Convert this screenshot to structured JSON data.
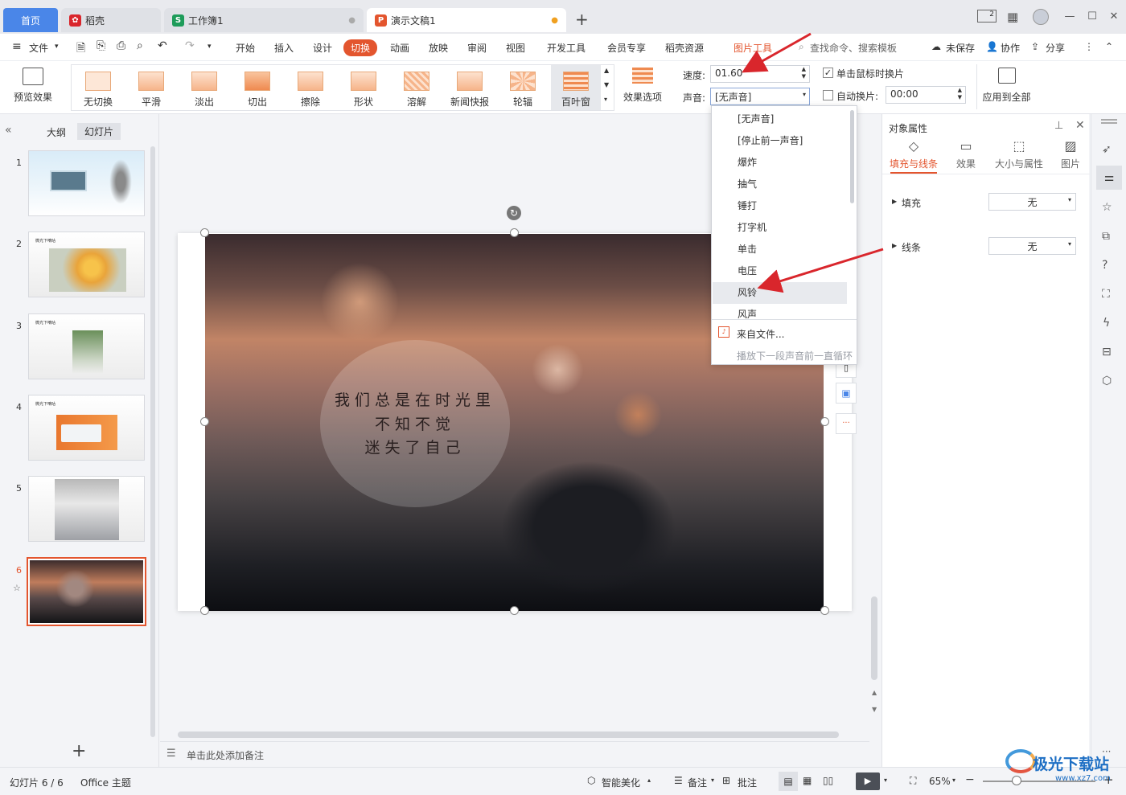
{
  "tabs": [
    {
      "label": "首页"
    },
    {
      "label": "稻壳"
    },
    {
      "label": "工作簿1"
    },
    {
      "label": "演示文稿1"
    }
  ],
  "window": {
    "add_tab": "+",
    "badge": "2"
  },
  "menu": {
    "file": "文件",
    "items": [
      "开始",
      "插入",
      "设计",
      "切换",
      "动画",
      "放映",
      "审阅",
      "视图",
      "开发工具",
      "会员专享",
      "稻壳资源",
      "图片工具"
    ],
    "search": "查找命令、搜索模板",
    "unsaved": "未保存",
    "collab": "协作",
    "share": "分享"
  },
  "ribbon": {
    "preview": "预览效果",
    "effects": [
      "无切换",
      "平滑",
      "淡出",
      "切出",
      "擦除",
      "形状",
      "溶解",
      "新闻快报",
      "轮辐",
      "百叶窗"
    ],
    "effect_options": "效果选项",
    "speed_label": "速度:",
    "speed_value": "01.60",
    "sound_label": "声音:",
    "sound_value": "[无声音]",
    "click_switch": "单击鼠标时换片",
    "auto_switch": "自动换片:",
    "auto_time": "00:00",
    "apply_all": "应用到全部"
  },
  "sound_menu": {
    "items": [
      "[无声音]",
      "[停止前一声音]",
      "爆炸",
      "抽气",
      "锤打",
      "打字机",
      "单击",
      "电压",
      "风铃",
      "风声"
    ],
    "selected": "风铃",
    "from_file": "来自文件...",
    "loop": "播放下一段声音前一直循环"
  },
  "left_panel": {
    "outline": "大纲",
    "slides": "幻灯片",
    "slide_numbers": [
      "1",
      "2",
      "3",
      "4",
      "5",
      "6"
    ],
    "slide_titles": [
      "",
      "微光下嘀咕",
      "微光下嘀咕",
      "微光下嘀咕",
      "",
      ""
    ],
    "add": "+"
  },
  "slide": {
    "lines": [
      "我们总是在时光里",
      "不知不觉",
      "迷失了自己"
    ]
  },
  "notes": {
    "placeholder": "单击此处添加备注"
  },
  "right_panel": {
    "title": "对象属性",
    "tabs": [
      "填充与线条",
      "效果",
      "大小与属性",
      "图片"
    ],
    "fill_label": "填充",
    "fill_value": "无",
    "line_label": "线条",
    "line_value": "无"
  },
  "status": {
    "slide_info": "幻灯片 6 / 6",
    "theme": "Office 主题",
    "beautify": "智能美化",
    "notes": "备注",
    "comment": "批注",
    "zoom": "65%"
  },
  "watermark": {
    "text": "极光下载站",
    "url": "www.xz7.com"
  },
  "colors": {
    "accent": "#e3552e",
    "active_tab_bg": "#4a86e8",
    "arrow": "#d9262c"
  }
}
